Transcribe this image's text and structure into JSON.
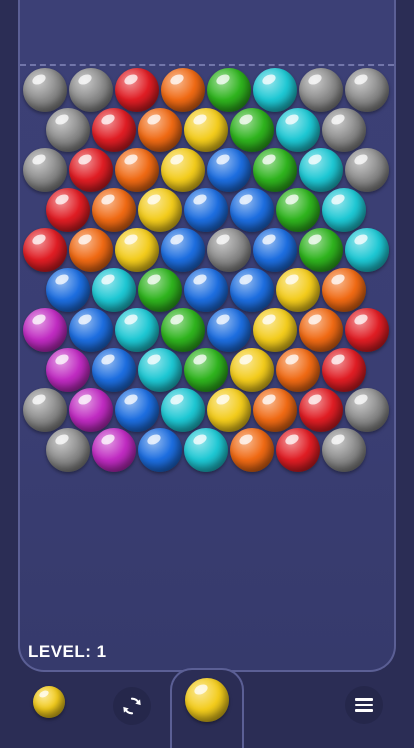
{
  "level_label": "LEVEL: 1",
  "colors": {
    "R": "#e01d24",
    "O": "#f06a14",
    "Y": "#f3cc1c",
    "G": "#2fb41e",
    "C": "#1ec8d4",
    "B": "#1d6ee0",
    "P": "#c02bc2",
    "S": "#8c8c8c"
  },
  "grid": [
    [
      "S",
      "S",
      "R",
      "O",
      "G",
      "C",
      "S",
      "S"
    ],
    [
      "S",
      "R",
      "O",
      "Y",
      "G",
      "C",
      "S"
    ],
    [
      "S",
      "R",
      "O",
      "Y",
      "B",
      "G",
      "C",
      "S"
    ],
    [
      "R",
      "O",
      "Y",
      "B",
      "B",
      "G",
      "C"
    ],
    [
      "R",
      "O",
      "Y",
      "B",
      "S",
      "B",
      "G",
      "C"
    ],
    [
      "B",
      "C",
      "G",
      "B",
      "B",
      "Y",
      "O"
    ],
    [
      "P",
      "B",
      "C",
      "G",
      "B",
      "Y",
      "O",
      "R"
    ],
    [
      "P",
      "B",
      "C",
      "G",
      "Y",
      "O",
      "R"
    ],
    [
      "S",
      "P",
      "B",
      "C",
      "Y",
      "O",
      "R",
      "S"
    ],
    [
      "S",
      "P",
      "B",
      "C",
      "O",
      "R",
      "S"
    ]
  ],
  "next_bubble_color": "Y",
  "current_bubble_color": "Y",
  "icons": {
    "swap": "swap-icon",
    "menu": "hamburger-menu-icon"
  }
}
